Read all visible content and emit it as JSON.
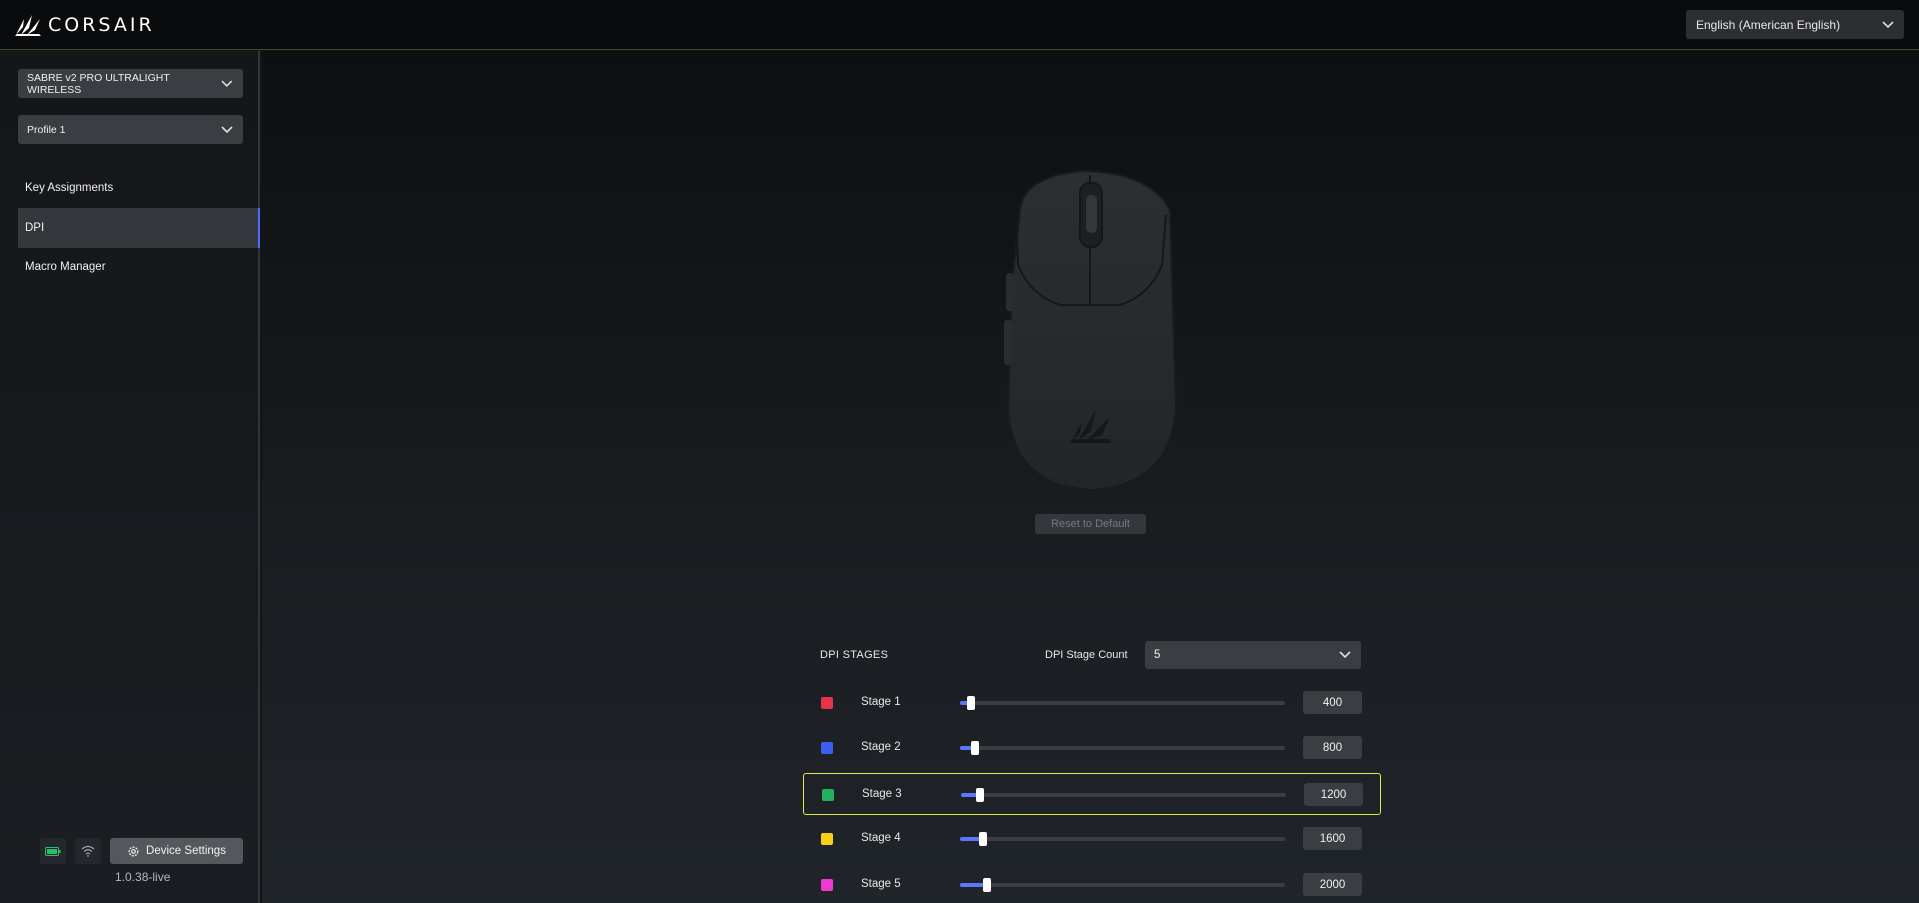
{
  "header": {
    "brand": "CORSAIR",
    "language": "English (American English)"
  },
  "sidebar": {
    "device": "SABRE v2 PRO ULTRALIGHT WIRELESS",
    "profile": "Profile 1",
    "items": [
      {
        "label": "Key Assignments",
        "active": false
      },
      {
        "label": "DPI",
        "active": true
      },
      {
        "label": "Macro Manager",
        "active": false
      }
    ],
    "device_settings_label": "Device Settings",
    "version": "1.0.38-live"
  },
  "main": {
    "reset_label": "Reset to Default",
    "dpi_stages_title": "DPI STAGES",
    "stage_count_label": "DPI Stage Count",
    "stage_count_value": "5",
    "dpi_max": 33000,
    "stages": [
      {
        "label": "Stage 1",
        "value": "400",
        "color": "#e8334a",
        "selected": false
      },
      {
        "label": "Stage 2",
        "value": "800",
        "color": "#3a5ff0",
        "selected": false
      },
      {
        "label": "Stage 3",
        "value": "1200",
        "color": "#22b15c",
        "selected": true
      },
      {
        "label": "Stage 4",
        "value": "1600",
        "color": "#f5d016",
        "selected": false
      },
      {
        "label": "Stage 5",
        "value": "2000",
        "color": "#ec3ad2",
        "selected": false
      }
    ]
  },
  "icons": {
    "logo": "corsair-sails-icon",
    "battery": "battery-icon",
    "wireless": "wireless-icon",
    "settings": "gear-icon",
    "dropdown": "chevron-down-icon"
  }
}
